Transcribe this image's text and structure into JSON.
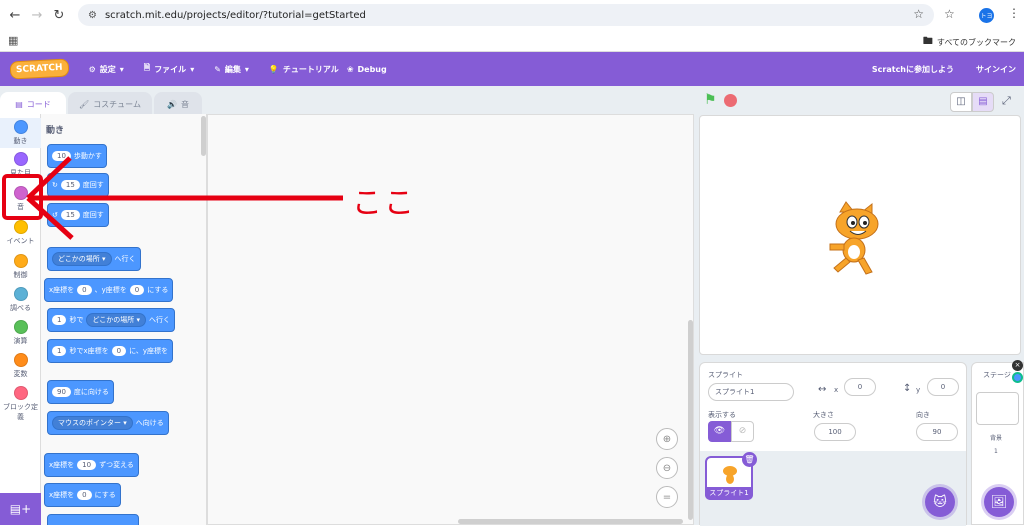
{
  "browser": {
    "url": "scratch.mit.edu/projects/editor/?tutorial=getStarted",
    "bookmarks_label": "すべてのブックマーク",
    "profile_initials": "トヨ"
  },
  "menu": {
    "logo": "SCRATCH",
    "settings": "設定",
    "file": "ファイル",
    "edit": "編集",
    "tutorial": "チュートリアル",
    "debug": "Debug",
    "join": "Scratchに参加しよう",
    "signin": "サインイン"
  },
  "tabs": {
    "code": "コード",
    "costume": "コスチューム",
    "sound": "音"
  },
  "categories": [
    {
      "label": "動き",
      "color": "#4c97ff"
    },
    {
      "label": "見た目",
      "color": "#9966ff"
    },
    {
      "label": "音",
      "color": "#cf63cf"
    },
    {
      "label": "イベント",
      "color": "#ffbf00"
    },
    {
      "label": "制御",
      "color": "#ffab19"
    },
    {
      "label": "調べる",
      "color": "#5cb1d6"
    },
    {
      "label": "演算",
      "color": "#59c059"
    },
    {
      "label": "変数",
      "color": "#ff8c1a"
    },
    {
      "label": "ブロック定義",
      "color": "#ff6680"
    }
  ],
  "palette": {
    "title": "動き",
    "blocks": {
      "move": {
        "val": "10",
        "text": "歩動かす"
      },
      "turn_right": {
        "val": "15",
        "text": "度回す"
      },
      "turn_left": {
        "val": "15",
        "text": "度回す"
      },
      "goto": {
        "drop": "どこかの場所",
        "text": "へ行く"
      },
      "gotoxy": {
        "t1": "x座標を",
        "x": "0",
        "t2": "、y座標を",
        "y": "0",
        "t3": "にする"
      },
      "glide": {
        "val": "1",
        "t1": "秒で",
        "drop": "どこかの場所",
        "t2": "へ行く"
      },
      "glidexy": {
        "val": "1",
        "t1": "秒でx座標を",
        "x": "0",
        "t2": "に、y座標を"
      },
      "point": {
        "val": "90",
        "text": "度に向ける"
      },
      "pointto": {
        "drop": "マウスのポインター",
        "text": "へ向ける"
      },
      "changex": {
        "t1": "x座標を",
        "val": "10",
        "t2": "ずつ変える"
      },
      "setx": {
        "t1": "x座標を",
        "val": "0",
        "t2": "にする"
      }
    }
  },
  "annotation": {
    "text": "ここ",
    "color": "#e60012"
  },
  "sprite_info": {
    "label": "スプライト",
    "name": "スプライト1",
    "x_label": "x",
    "x": "0",
    "y_label": "y",
    "y": "0",
    "show_label": "表示する",
    "size_label": "大きさ",
    "size": "100",
    "direction_label": "向き",
    "direction": "90",
    "thumb_label": "スプライト1"
  },
  "stage_pane": {
    "label": "ステージ",
    "backdrops_label": "背景",
    "backdrops_count": "1"
  },
  "colors": {
    "scratch_purple": "#855cd6",
    "motion_blue": "#4c97ff"
  }
}
